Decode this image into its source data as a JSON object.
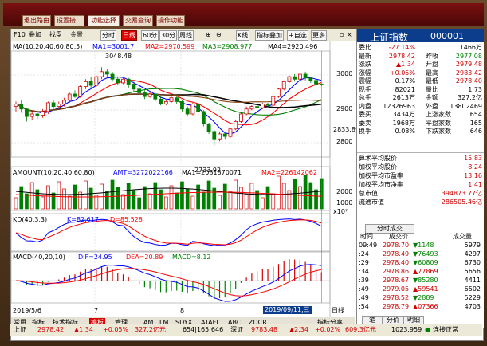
{
  "top_menu": [
    "退出路由",
    "设置接口",
    "功能选择",
    "交易查询",
    "操作功能"
  ],
  "toolbar": {
    "items": [
      "F10",
      "叠加",
      "找盘",
      "金景"
    ],
    "periods": [
      "分时",
      "日线",
      "60分",
      "30分",
      "周线"
    ],
    "active_period": "日线",
    "tools": [
      "K线",
      "指标叠加",
      "+自选",
      "更多"
    ]
  },
  "indicators": {
    "ma_label": "MA",
    "ma_params": "(10,20,40,60,80,5)",
    "ma1": "MA1=3001.7",
    "ma2": "MA2=2970.599",
    "ma3": "MA3=2908.977",
    "ma4": "MA4=2920.496",
    "high_label": "3048.48",
    "low_label": "2733.92",
    "price_axis": [
      "3000",
      "2900",
      "2833.89",
      "2800"
    ],
    "amount_label": "AMOUNT",
    "amount_params": "(10,20,40,60,80)",
    "amt": "AMT=3272022166",
    "amt_ma1": "MA1=2081870071",
    "amt_ma2": "MA2=226142062",
    "amount_axis": [
      "2000",
      "1000",
      "x10⁷"
    ],
    "kd_label": "KD",
    "kd_params": "(40,3,3)",
    "kd_k": "K=82.617",
    "kd_d": "D=85.528",
    "macd_label": "MACD",
    "macd_params": "(40,20,10)",
    "macd_dif": "DIF=24.95",
    "macd_dea": "DEA=20.89",
    "macd_val": "MACD=8.12",
    "date_left": "2019/5/6",
    "date_m1": "7",
    "date_m2": "8",
    "date_cursor": "2019/09/11,三"
  },
  "bottom_tabs": [
    "常用",
    "指标",
    "技术指标",
    "模板",
    "管理",
    "AM",
    "LM",
    "SDYX",
    "ATAFI",
    "ABC",
    "ZDCR",
    "指标分享"
  ],
  "bottom_active": "模板",
  "quote": {
    "name": "上证指数",
    "code": "000001",
    "rows": [
      {
        "l1": "委比",
        "v1": "-27.14%",
        "l2": "",
        "v2": "1466万"
      },
      {
        "l1": "最新",
        "v1": "2978.42",
        "l2": "昨收",
        "v2": "2977.08"
      },
      {
        "l1": "涨跌",
        "v1": "▲1.34",
        "l2": "开盘",
        "v2": "2979.48"
      },
      {
        "l1": "涨幅",
        "v1": "+0.05%",
        "l2": "最高",
        "v2": "2983.42"
      },
      {
        "l1": "震幅",
        "v1": "0.17%",
        "l2": "最低",
        "v2": "2978.40"
      },
      {
        "l1": "现手",
        "v1": "82021",
        "l2": "量比",
        "v2": "1.73"
      },
      {
        "l1": "总手",
        "v1": "2613万",
        "l2": "金额",
        "v2": "327.2亿"
      },
      {
        "l1": "内盘",
        "v1": "12326963",
        "l2": "外盘",
        "v2": "13802469"
      },
      {
        "l1": "委买",
        "v1": "3434万",
        "l2": "上涨家数",
        "v2": "654"
      },
      {
        "l1": "委卖",
        "v1": "1968万",
        "l2": "平盘家数",
        "v2": "165"
      },
      {
        "l1": "换手",
        "v1": "0.08%",
        "l2": "下跌家数",
        "v2": "646"
      }
    ],
    "stats": [
      {
        "l": "算术平均股价",
        "v": "15.83"
      },
      {
        "l": "加权平均股价",
        "v": "8.24"
      },
      {
        "l": "加权平均市盈率",
        "v": "13.16"
      },
      {
        "l": "加权平均市净率",
        "v": "1.41"
      },
      {
        "l": "总市值",
        "v": "394873.77亿"
      },
      {
        "l": "流通市值",
        "v": "286505.46亿"
      }
    ],
    "trade_header": "分时成交",
    "trade_cols": [
      "时间",
      "成交价",
      "成交量"
    ],
    "trades": [
      {
        "t": "09:49",
        "p": "2978.70",
        "m": "▼1148",
        "v": "5979"
      },
      {
        "t": ":24",
        "p": "2978.49",
        "m": "▼76493",
        "v": "4297"
      },
      {
        "t": ":29",
        "p": "2978.40",
        "m": "▼60809",
        "v": "6730"
      },
      {
        "t": ":34",
        "p": "2978.86",
        "m": "▲77869",
        "v": "5656"
      },
      {
        "t": ":39",
        "p": "2978.67",
        "m": "▼85280",
        "v": "4411"
      },
      {
        "t": ":49",
        "p": "2979.05",
        "m": "▲59541",
        "v": "6502"
      },
      {
        "t": ":49",
        "p": "2978.52",
        "m": "▼2889",
        "v": "5229"
      },
      {
        "t": ":54",
        "p": "2978.79",
        "m": "▲07366",
        "v": "4703"
      }
    ],
    "panel_tabs": [
      "笔",
      "分价",
      "明细"
    ]
  },
  "status_bar": {
    "name": "上证",
    "price": "2978.42",
    "chg": "▲1.34",
    "pct": "+0.05%",
    "amt": "327.2亿元",
    "count": "654|165|646",
    "sz_name": "深证",
    "sz_price": "9783.48",
    "sz_chg": "▲2.34",
    "sz_pct": "+0.02%",
    "sz_amt": "609.3亿元",
    "extra": "1023.959",
    "link": "连接正常"
  },
  "colors": {
    "up": "#d00000",
    "down": "#008000",
    "ma1": "#0000ff",
    "ma2": "#ff0000",
    "ma3": "#008000",
    "ma4": "#000000",
    "ma5": "#8b4513"
  },
  "chart_data": {
    "type": "candlestick",
    "x_range": [
      "2019/5/6",
      "2019/09/11"
    ],
    "price_ylim": [
      2700,
      3100
    ],
    "candles": [
      [
        2890,
        2900,
        2870,
        2910
      ],
      [
        2900,
        2880,
        2865,
        2915
      ],
      [
        2880,
        2850,
        2830,
        2885
      ],
      [
        2850,
        2860,
        2835,
        2875
      ],
      [
        2860,
        2855,
        2840,
        2870
      ],
      [
        2855,
        2870,
        2845,
        2880
      ],
      [
        2870,
        2905,
        2860,
        2910
      ],
      [
        2905,
        2890,
        2880,
        2915
      ],
      [
        2890,
        2900,
        2885,
        2910
      ],
      [
        2900,
        2915,
        2890,
        2925
      ],
      [
        2915,
        2940,
        2905,
        2945
      ],
      [
        2940,
        2930,
        2925,
        2955
      ],
      [
        2930,
        2970,
        2925,
        2975
      ],
      [
        2970,
        2990,
        2960,
        3000
      ],
      [
        2990,
        2975,
        2965,
        3010
      ],
      [
        2975,
        3010,
        2970,
        3015
      ],
      [
        3010,
        3030,
        3000,
        3048
      ],
      [
        3030,
        3020,
        3005,
        3040
      ],
      [
        3020,
        3000,
        2990,
        3030
      ],
      [
        3000,
        2985,
        2975,
        3010
      ],
      [
        2985,
        3000,
        2980,
        3005
      ],
      [
        3000,
        2980,
        2965,
        3005
      ],
      [
        2980,
        2960,
        2950,
        2990
      ],
      [
        2960,
        2945,
        2940,
        2970
      ],
      [
        2945,
        2930,
        2920,
        2955
      ],
      [
        2930,
        2940,
        2925,
        2950
      ],
      [
        2940,
        2920,
        2910,
        2945
      ],
      [
        2920,
        2900,
        2895,
        2930
      ],
      [
        2900,
        2910,
        2895,
        2915
      ],
      [
        2910,
        2925,
        2905,
        2930
      ],
      [
        2925,
        2910,
        2900,
        2935
      ],
      [
        2910,
        2880,
        2870,
        2915
      ],
      [
        2880,
        2860,
        2850,
        2890
      ],
      [
        2860,
        2900,
        2855,
        2905
      ],
      [
        2900,
        2870,
        2860,
        2905
      ],
      [
        2870,
        2820,
        2810,
        2875
      ],
      [
        2820,
        2790,
        2780,
        2825
      ],
      [
        2790,
        2760,
        2734,
        2795
      ],
      [
        2760,
        2780,
        2750,
        2790
      ],
      [
        2780,
        2770,
        2760,
        2790
      ],
      [
        2770,
        2800,
        2765,
        2805
      ],
      [
        2800,
        2830,
        2795,
        2835
      ],
      [
        2830,
        2860,
        2825,
        2865
      ],
      [
        2860,
        2880,
        2855,
        2890
      ],
      [
        2880,
        2890,
        2875,
        2895
      ],
      [
        2890,
        2885,
        2880,
        2900
      ],
      [
        2885,
        2900,
        2880,
        2905
      ],
      [
        2900,
        2895,
        2885,
        2905
      ],
      [
        2895,
        2930,
        2890,
        2935
      ],
      [
        2930,
        2960,
        2925,
        2965
      ],
      [
        2960,
        2990,
        2955,
        2995
      ],
      [
        2990,
        3010,
        2985,
        3015
      ],
      [
        3010,
        3000,
        2990,
        3020
      ],
      [
        3000,
        3020,
        2995,
        3025
      ],
      [
        3020,
        3005,
        2995,
        3030
      ],
      [
        3005,
        2995,
        2985,
        3010
      ],
      [
        2995,
        2980,
        2975,
        3005
      ],
      [
        2980,
        2978,
        2972,
        2985
      ]
    ]
  }
}
